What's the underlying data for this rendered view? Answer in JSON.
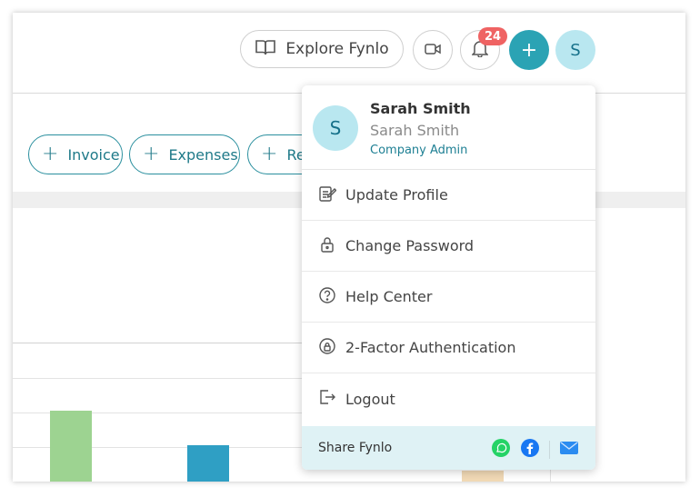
{
  "header": {
    "explore_label": "Explore Fynlo",
    "notification_count": "24",
    "plus_label": "+",
    "avatar_initial": "S"
  },
  "quick_actions": [
    {
      "label": "Invoice"
    },
    {
      "label": "Expenses"
    },
    {
      "label": "Re"
    }
  ],
  "chart_bars": [
    {
      "color": "#9dd391"
    },
    {
      "color": "#2f9fc4"
    },
    {
      "color": "#f1d9b5"
    }
  ],
  "profile": {
    "initial": "S",
    "name": "Sarah Smith",
    "subname": "Sarah Smith",
    "role": "Company Admin"
  },
  "menu": {
    "items": [
      {
        "label": "Update Profile",
        "icon": "edit-icon"
      },
      {
        "label": "Change Password",
        "icon": "lock-icon"
      },
      {
        "label": "Help Center",
        "icon": "help-icon"
      },
      {
        "label": "2-Factor Authentication",
        "icon": "shield-lock-icon"
      },
      {
        "label": "Logout",
        "icon": "logout-icon"
      }
    ]
  },
  "share": {
    "label": "Share Fynlo"
  },
  "colors": {
    "accent": "#2ba3b4",
    "avatar_bg": "#b9e7f0",
    "badge": "#ef6363",
    "share_bg": "#dff2f5"
  }
}
